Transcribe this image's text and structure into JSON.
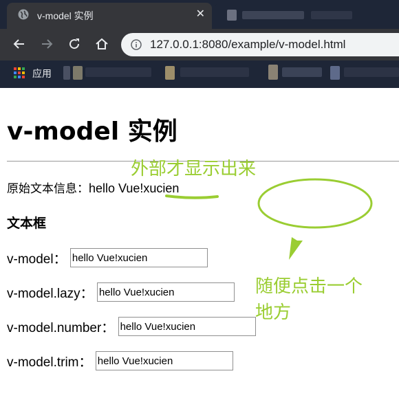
{
  "browser": {
    "tab_title": "v-model 实例",
    "tab_close": "✕",
    "url": "127.0.0.1:8080/example/v-model.html",
    "bookmarks_apps_label": "应用"
  },
  "page": {
    "heading": "v-model 实例",
    "original_label": "原始文本信息：",
    "original_value": "hello Vue!xucien",
    "section_heading": "文本框",
    "fields": [
      {
        "label": "v-model：",
        "value": "hello Vue!xucien"
      },
      {
        "label": "v-model.lazy：",
        "value": "hello Vue!xucien"
      },
      {
        "label": "v-model.number：",
        "value": "hello Vue!xucien"
      },
      {
        "label": "v-model.trim：",
        "value": "hello Vue!xucien"
      }
    ]
  },
  "annotations": {
    "top_note": "外部才显示出来",
    "right_note_line1": "随便点击一个",
    "right_note_line2": "地方",
    "color": "#9acd32"
  },
  "icons": [
    "globe-icon",
    "close-icon",
    "back-arrow-icon",
    "forward-arrow-icon",
    "reload-icon",
    "home-icon",
    "info-icon",
    "apps-grid-icon"
  ]
}
